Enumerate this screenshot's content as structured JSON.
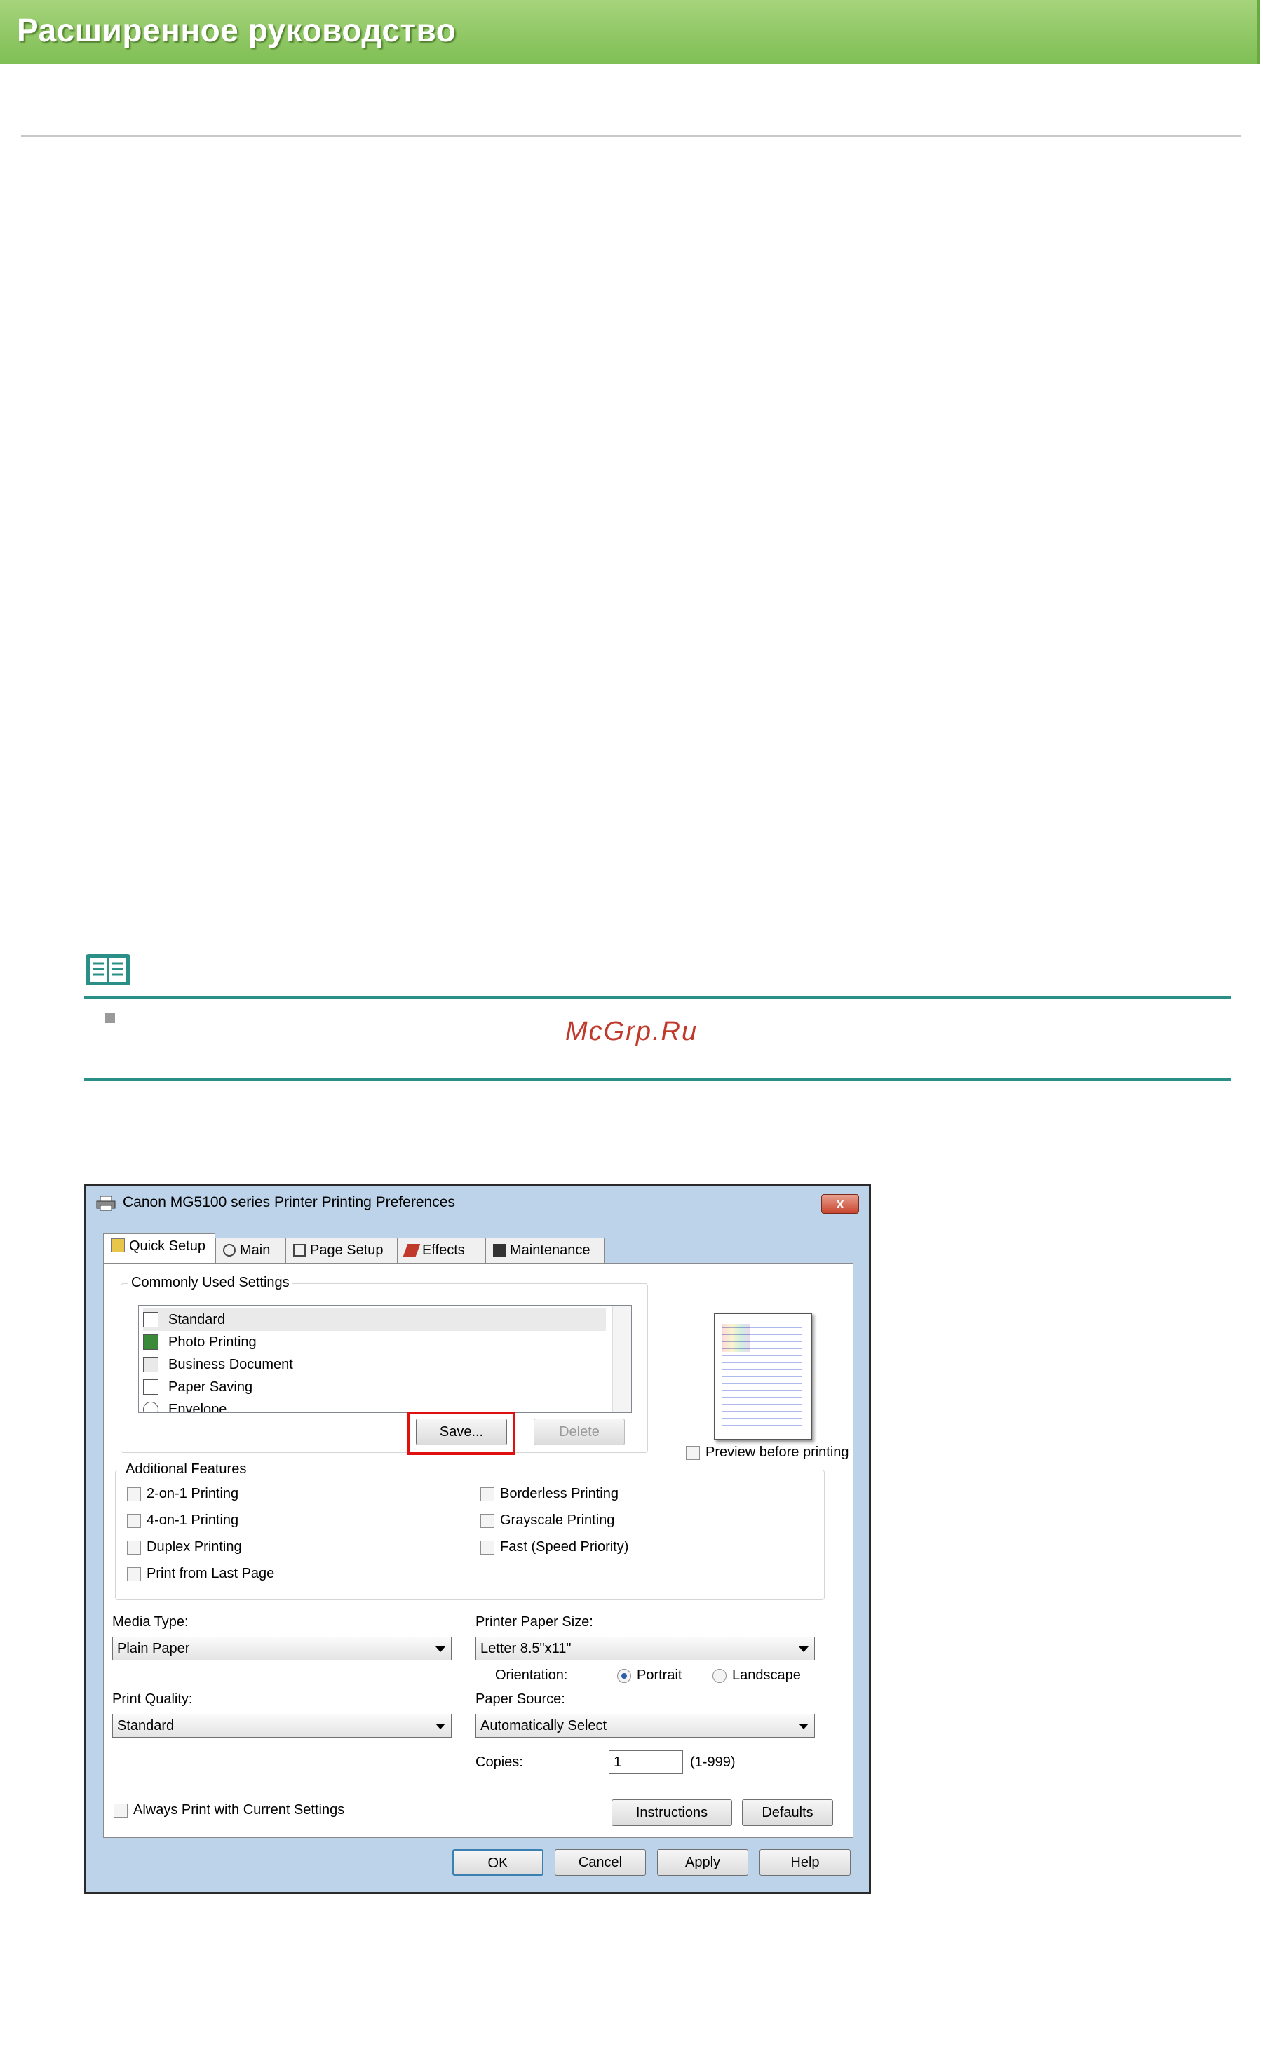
{
  "header": {
    "title": "Расширенное руководство"
  },
  "watermark": "McGrp.Ru",
  "dialog": {
    "title": "Canon MG5100 series Printer Printing Preferences",
    "close_symbol": "x",
    "tabs": [
      {
        "label": "Quick Setup"
      },
      {
        "label": "Main"
      },
      {
        "label": "Page Setup"
      },
      {
        "label": "Effects"
      },
      {
        "label": "Maintenance"
      }
    ],
    "commonly_used": {
      "title": "Commonly Used Settings",
      "items": [
        {
          "label": "Standard"
        },
        {
          "label": "Photo Printing"
        },
        {
          "label": "Business Document"
        },
        {
          "label": "Paper Saving"
        },
        {
          "label": "Envelope"
        }
      ],
      "save_label": "Save...",
      "delete_label": "Delete"
    },
    "preview_label": "Preview before printing",
    "additional": {
      "title": "Additional Features",
      "left": [
        {
          "label": "2-on-1 Printing"
        },
        {
          "label": "4-on-1 Printing"
        },
        {
          "label": "Duplex Printing"
        },
        {
          "label": "Print from Last Page"
        }
      ],
      "right": [
        {
          "label": "Borderless Printing"
        },
        {
          "label": "Grayscale Printing"
        },
        {
          "label": "Fast (Speed Priority)"
        }
      ]
    },
    "media_type": {
      "label": "Media Type:",
      "value": "Plain Paper"
    },
    "paper_size": {
      "label": "Printer Paper Size:",
      "value": "Letter 8.5\"x11\""
    },
    "orientation": {
      "label": "Orientation:",
      "portrait": "Portrait",
      "landscape": "Landscape",
      "selected": "Portrait"
    },
    "print_quality": {
      "label": "Print Quality:",
      "value": "Standard"
    },
    "paper_source": {
      "label": "Paper Source:",
      "value": "Automatically Select"
    },
    "copies": {
      "label": "Copies:",
      "value": "1",
      "range": "(1-999)"
    },
    "always_print_label": "Always Print with Current Settings",
    "instructions_label": "Instructions",
    "defaults_label": "Defaults",
    "ok_label": "OK",
    "cancel_label": "Cancel",
    "apply_label": "Apply",
    "help_label": "Help"
  }
}
